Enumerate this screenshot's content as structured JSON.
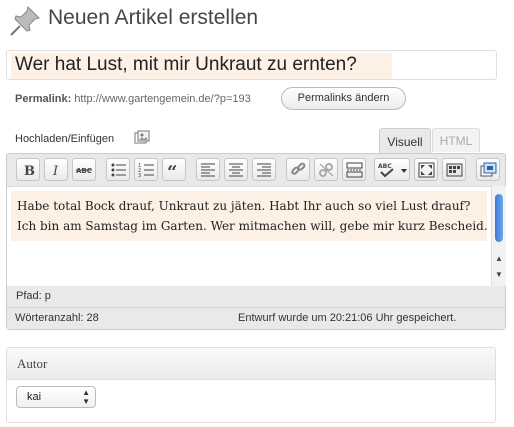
{
  "page": {
    "title": "Neuen Artikel erstellen"
  },
  "post": {
    "title_value": "Wer hat Lust, mit mir Unkraut zu ernten?",
    "permalink_label": "Permalink:",
    "permalink_url": "http://www.gartengemein.de/?p=193",
    "permalink_button": "Permalinks ändern"
  },
  "editor": {
    "upload_label": "Hochladen/Einfügen",
    "tabs": [
      {
        "label": "Visuell",
        "active": true
      },
      {
        "label": "HTML",
        "active": false
      }
    ],
    "toolbar_icons": [
      "bold-icon",
      "italic-icon",
      "strikethrough-icon",
      "bullet-list-icon",
      "numbered-list-icon",
      "blockquote-icon",
      "align-left-icon",
      "align-center-icon",
      "align-right-icon",
      "link-icon",
      "unlink-icon",
      "more-tag-icon",
      "spellcheck-icon",
      "fullscreen-icon",
      "kitchen-sink-icon"
    ],
    "content": "Habe total Bock drauf, Unkraut zu jäten. Habt Ihr auch so viel Lust drauf? Ich bin am Samstag im Garten. Wer mitmachen will, gebe mir kurz Bescheid.",
    "path_label": "Pfad:",
    "path_value": "p",
    "word_count": "Wörteranzahl: 28",
    "autosave_status": "Entwurf wurde um 20:21:06 Uhr gespeichert."
  },
  "author_box": {
    "title": "Autor",
    "selected": "kai"
  },
  "colors": {
    "highlight": "#fdf0e4",
    "toolbar_bg": "#e9e9e9",
    "scroll_thumb": "#3a7bd5"
  }
}
